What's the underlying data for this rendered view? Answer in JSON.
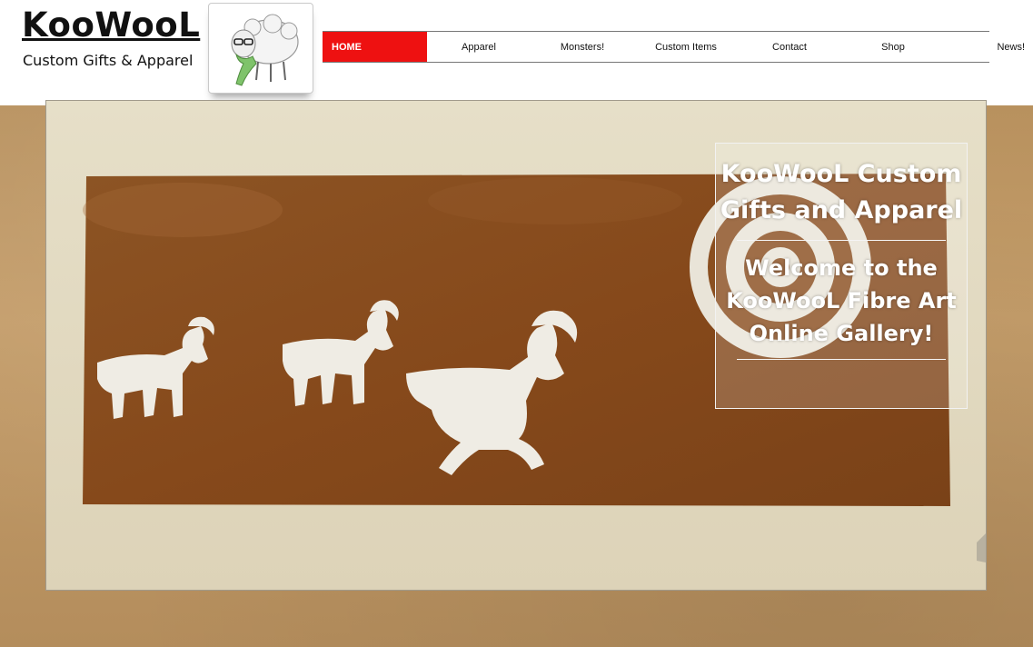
{
  "brand": {
    "title": "KooWooL",
    "subtitle": "Custom Gifts & Apparel"
  },
  "logo": {
    "icon": "sheep-with-scarf-icon"
  },
  "nav": {
    "items": [
      {
        "label": "HOME",
        "active": true
      },
      {
        "label": "Apparel",
        "active": false
      },
      {
        "label": "Monsters!",
        "active": false
      },
      {
        "label": "Custom Items",
        "active": false
      },
      {
        "label": "Contact",
        "active": false
      },
      {
        "label": "Shop",
        "active": false
      },
      {
        "label": "News!",
        "active": false
      }
    ]
  },
  "hero": {
    "image": "felt-wall-art-goats-spiral",
    "overlay_title": "KooWooL Custom Gifts and Apparel",
    "overlay_body": "Welcome to the KooWooL Fibre Art Online Gallery!"
  },
  "colors": {
    "accent": "#ee1111",
    "felt": "#8a4e1e",
    "wall": "#e4dcc3",
    "background": "#b8915e"
  }
}
